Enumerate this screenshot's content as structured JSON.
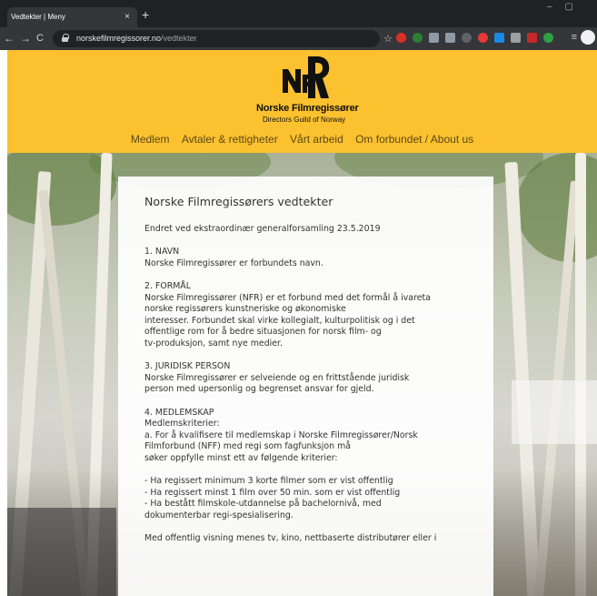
{
  "browser": {
    "tab_title": "Vedtekter | Meny",
    "tab_close": "×",
    "new_tab": "+",
    "url_domain": "norskefilmregissorer.no",
    "url_path": "/vedtekter"
  },
  "header": {
    "brand_name": "Norske Filmregissører",
    "brand_subtitle": "Directors Guild of Norway",
    "logo_text": "NFR",
    "nav": [
      "Medlem",
      "Avtaler & rettigheter",
      "Vårt arbeid",
      "Om forbundet / About us"
    ],
    "background_color": "#fcc12e"
  },
  "article": {
    "title": "Norske Filmregissørers vedtekter",
    "intro": "Endret ved ekstraordinær generalforsamling 23.5.2019",
    "sections": [
      {
        "heading": "1. NAVN",
        "lines": [
          "Norske Filmregissører er forbundets navn."
        ]
      },
      {
        "heading": "2. FORMÅL",
        "lines": [
          "Norske Filmregissører (NFR) er et forbund med det formål å ivareta",
          "norske regissørers kunstneriske og økonomiske",
          "interesser. Forbundet skal virke kollegialt, kulturpolitisk og i det",
          "offentlige rom for å bedre situasjonen for norsk film- og",
          "tv-produksjon, samt nye medier."
        ]
      },
      {
        "heading": "3. JURIDISK PERSON",
        "lines": [
          "Norske Filmregissører er selveiende og en frittstående juridisk",
          "person med upersonlig og begrenset ansvar for gjeld."
        ]
      },
      {
        "heading": "4. MEDLEMSKAP",
        "lines": [
          "Medlemskriterier:",
          "a. For å kvalifisere til medlemskap i Norske Filmregissører/Norsk",
          "Filmforbund (NFF) med regi som fagfunksjon må",
          "søker oppfylle minst ett av følgende kriterier:"
        ]
      }
    ],
    "criteria": [
      "- Ha regissert minimum 3 korte filmer som er vist offentlig",
      "- Ha regissert minst 1 film over 50 min. som er vist offentlig",
      "- Ha bestått filmskole-utdannelse på bachelornivå, med",
      "dokumenterbar regi-spesialisering."
    ],
    "trailing": "Med offentlig visning menes tv, kino, nettbaserte distributører eller i"
  }
}
